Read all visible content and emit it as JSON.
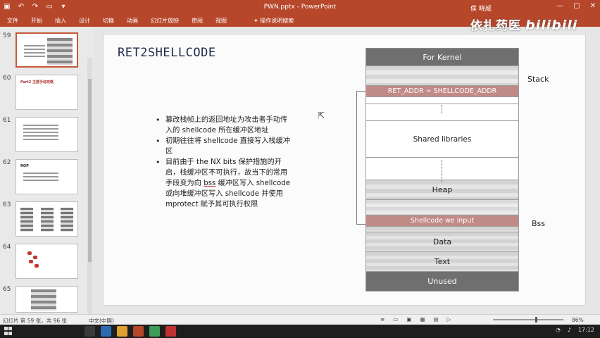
{
  "window": {
    "title": "PWN.pptx - PowerPoint",
    "user": "侯 晓威",
    "watermark_text": "依扎药医",
    "watermark_logo": "bilibili"
  },
  "ribbon": {
    "tabs": [
      "文件",
      "开始",
      "插入",
      "设计",
      "切换",
      "动画",
      "幻灯片放映",
      "审阅",
      "视图"
    ],
    "search": "操作说明搜索"
  },
  "thumbnails": [
    {
      "number": "59",
      "active": true,
      "title": ""
    },
    {
      "number": "60",
      "active": false,
      "title": "Part2 主要手动攻略"
    },
    {
      "number": "61",
      "active": false,
      "title": ""
    },
    {
      "number": "62",
      "active": false,
      "title": "ROP"
    },
    {
      "number": "63",
      "active": false,
      "title": ""
    },
    {
      "number": "64",
      "active": false,
      "title": ""
    },
    {
      "number": "65",
      "active": false,
      "title": ""
    }
  ],
  "slide": {
    "title": "RET2SHELLCODE",
    "bullets": [
      {
        "before": "篡改栈帧上的返回地址为攻击者手动传入的 shellcode 所在缓冲区地址",
        "mark": "",
        "after": ""
      },
      {
        "before": "初期往往将 shellcode 直接写入栈缓冲区",
        "mark": "",
        "after": ""
      },
      {
        "before": "目前由于 the NX bits 保护措施的开启，栈缓冲区不可执行，故当下的常用手段变为向 ",
        "mark": "bss",
        "after": " 缓冲区写入 shellcode 或向堆缓冲区写入 shellcode 并使用 mprotect 赋予其可执行权限"
      }
    ],
    "memory": {
      "for_kernel": "For Kernel",
      "ret_addr": "RET_ADDR = SHELLCODE_ADDR",
      "shared_libs": "Shared libraries",
      "heap": "Heap",
      "shellcode_input": "Shellcode we input",
      "data": "Data",
      "text": "Text",
      "unused": "Unused",
      "stack_label": "Stack",
      "bss_label": "Bss"
    }
  },
  "status": {
    "slide_info": "幻灯片 第 59 张，共 96 张",
    "language": "中文(中国)",
    "zoom": "86%",
    "time": "17:12"
  },
  "colors": {
    "ribbon": "#b7472a",
    "highlight_row": "#c08a86",
    "dark_row": "#6f6f6f"
  }
}
